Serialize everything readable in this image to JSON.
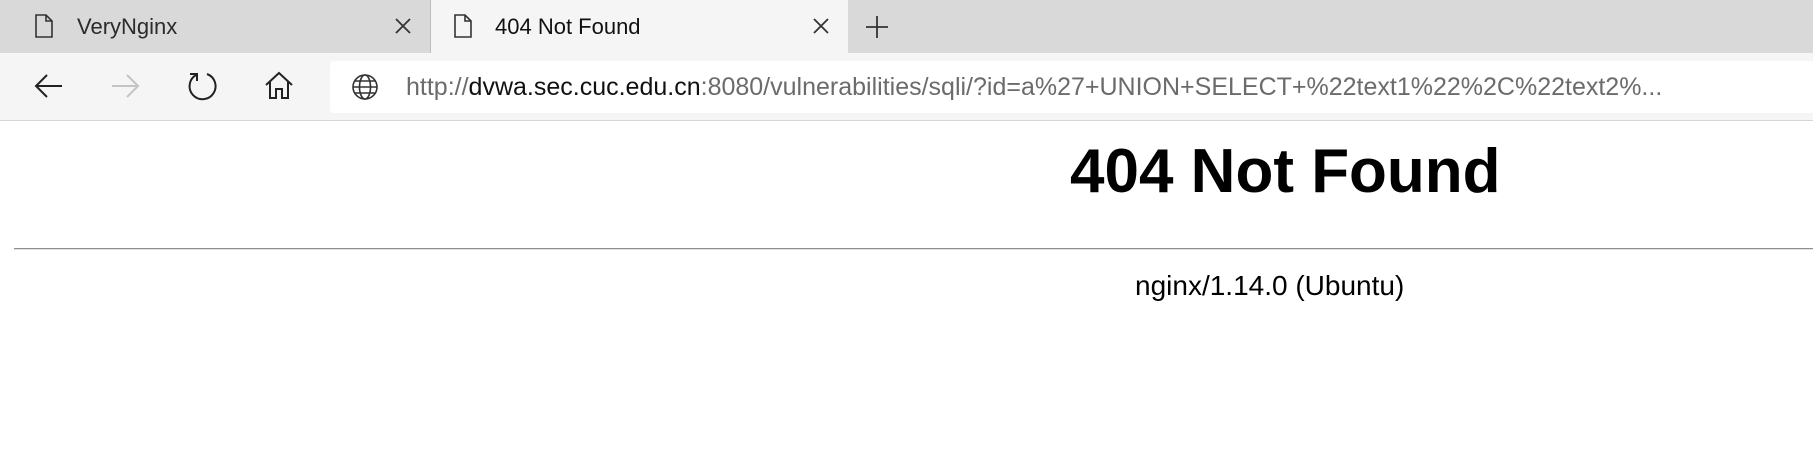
{
  "tabs": [
    {
      "title": "VeryNginx",
      "active": false
    },
    {
      "title": "404 Not Found",
      "active": true
    }
  ],
  "navbar": {
    "url_prefix": "http://",
    "url_domain": "dvwa.sec.cuc.edu.cn",
    "url_rest": ":8080/vulnerabilities/sqli/?id=a%27+UNION+SELECT+%22text1%22%2C%22text2%..."
  },
  "page": {
    "heading": "404 Not Found",
    "server": "nginx/1.14.0 (Ubuntu)"
  },
  "colors": {
    "tabstrip": "#d9d9d9",
    "active_tab": "#f5f5f5",
    "url_muted": "#6b6b6b"
  }
}
